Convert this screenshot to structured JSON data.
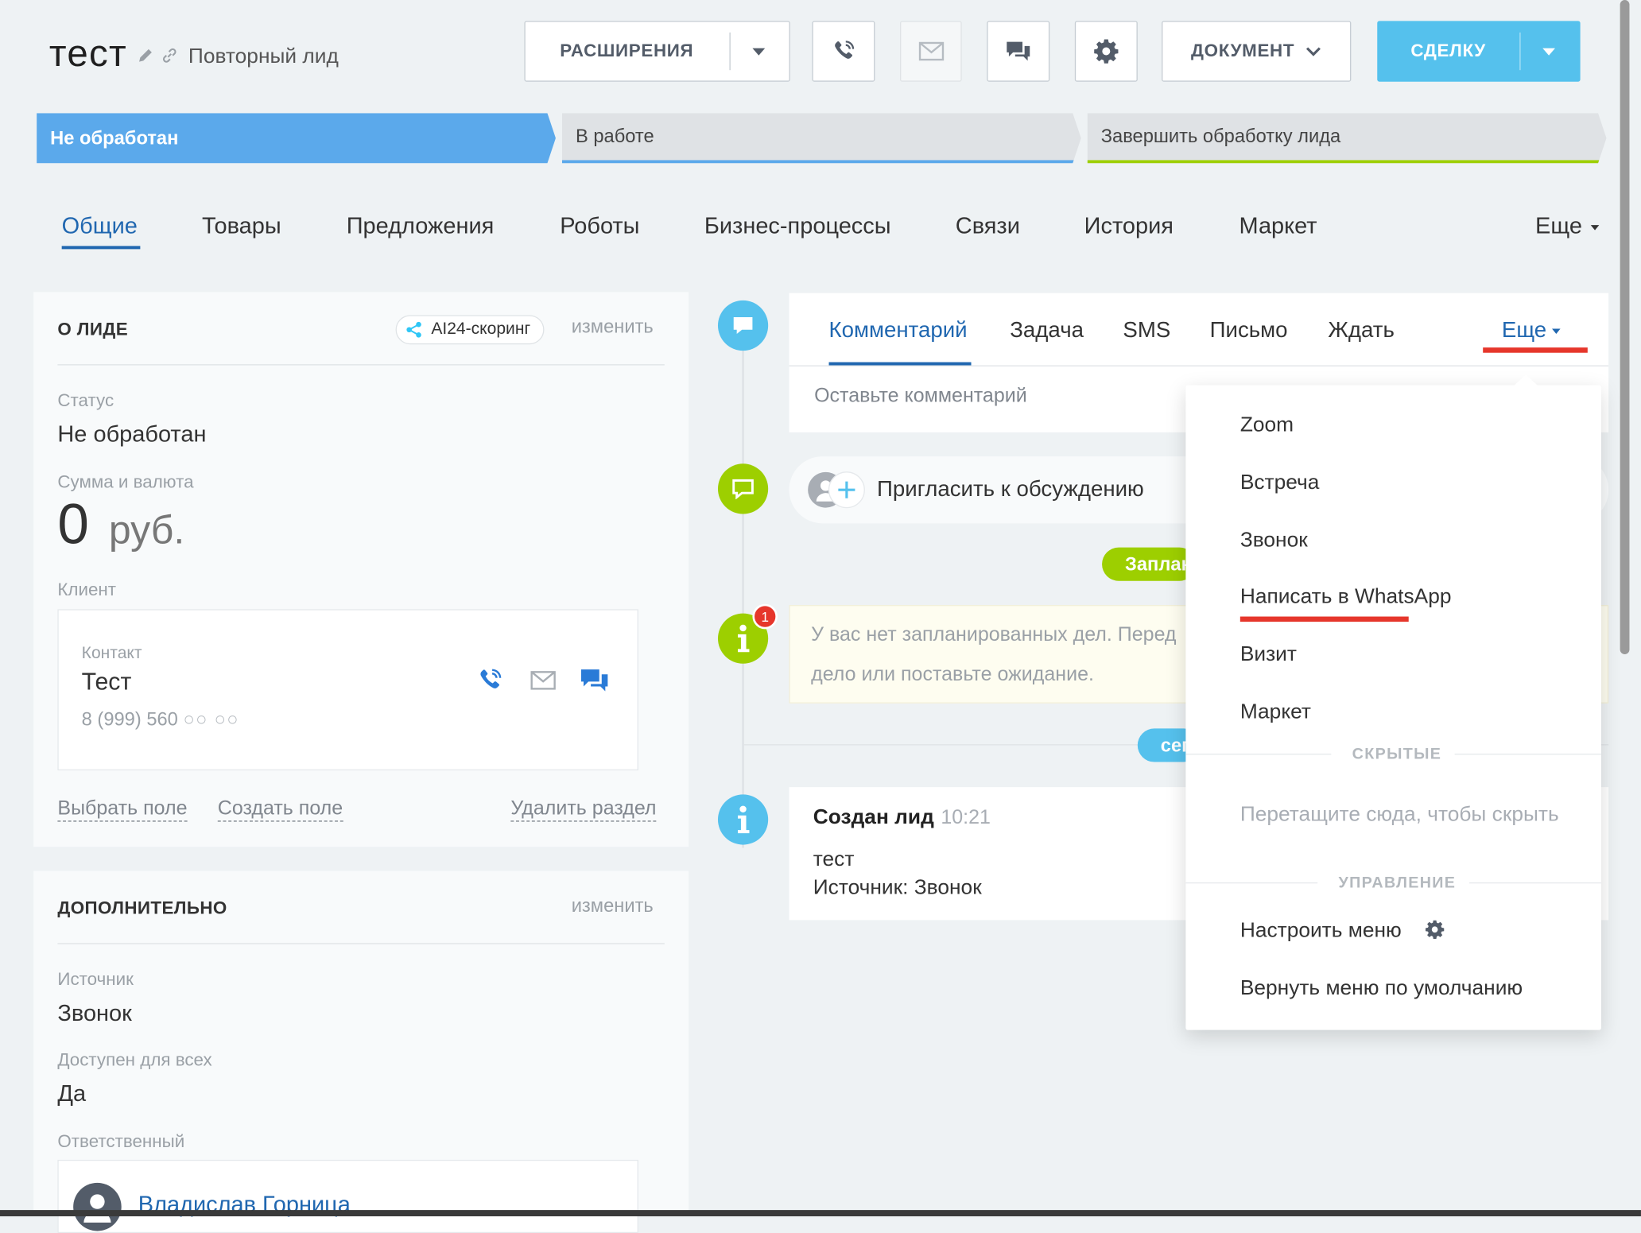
{
  "header": {
    "title": "тест",
    "subtitle": "Повторный лид",
    "extensions_label": "РАСШИРЕНИЯ",
    "document_label": "ДОКУМЕНТ",
    "deal_label": "СДЕЛКУ"
  },
  "stages": [
    {
      "label": "Не обработан"
    },
    {
      "label": "В работе"
    },
    {
      "label": "Завершить обработку лида"
    }
  ],
  "tabs": [
    {
      "label": "Общие"
    },
    {
      "label": "Товары"
    },
    {
      "label": "Предложения"
    },
    {
      "label": "Роботы"
    },
    {
      "label": "Бизнес-процессы"
    },
    {
      "label": "Связи"
    },
    {
      "label": "История"
    },
    {
      "label": "Маркет"
    },
    {
      "label": "Еще"
    }
  ],
  "about": {
    "title": "О ЛИДЕ",
    "scoring": "AI24-скоринг",
    "change": "изменить",
    "status_label": "Статус",
    "status_value": "Не обработан",
    "amount_label": "Сумма и валюта",
    "amount_value": "0",
    "amount_currency": "руб.",
    "client_label": "Клиент",
    "contact_label": "Контакт",
    "contact_name": "Тест",
    "contact_phone": "8 (999) 560 ",
    "contact_phone_hidden": "○○ ○○",
    "select_field": "Выбрать поле",
    "create_field": "Создать поле",
    "delete_section": "Удалить раздел"
  },
  "extra": {
    "title": "ДОПОЛНИТЕЛЬНО",
    "change": "изменить",
    "source_label": "Источник",
    "source_value": "Звонок",
    "available_label": "Доступен для всех",
    "available_value": "Да",
    "responsible_label": "Ответственный",
    "responsible_name": "Владислав Горница"
  },
  "timeline": {
    "tabs": [
      {
        "label": "Комментарий"
      },
      {
        "label": "Задача"
      },
      {
        "label": "SMS"
      },
      {
        "label": "Письмо"
      },
      {
        "label": "Ждать"
      },
      {
        "label": "Еще"
      }
    ],
    "comment_placeholder": "Оставьте комментарий",
    "invite": "Пригласить к обсуждению",
    "planned_pill": "Заплан",
    "today_pill": "сег",
    "notice_badge": "1",
    "notice_line1": "У вас нет запланированных дел. Перед",
    "notice_line2": "дело или поставьте ожидание.",
    "created_title": "Создан лид",
    "created_time": "10:21",
    "created_text": "тест",
    "created_source": "Источник: Звонок"
  },
  "menu": {
    "items": [
      "Zoom",
      "Встреча",
      "Звонок",
      "Написать в WhatsApp",
      "Визит",
      "Маркет"
    ],
    "hidden_section": "СКРЫТЫЕ",
    "hidden_hint": "Перетащите сюда, чтобы скрыть",
    "manage_section": "УПРАВЛЕНИЕ",
    "configure": "Настроить меню",
    "reset": "Вернуть меню по умолчанию"
  },
  "colors": {
    "accent_blue": "#5ba9eb",
    "link_blue": "#2067b0",
    "action_blue": "#55c1ed",
    "green": "#9dcf00",
    "highlight_red": "#e6362b"
  }
}
